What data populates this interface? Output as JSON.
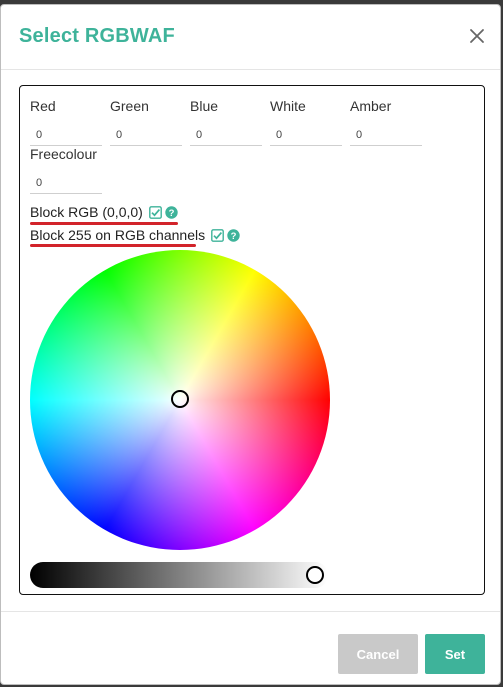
{
  "dialog": {
    "title": "Select RGBWAF",
    "close_icon": "close-icon"
  },
  "fields": [
    {
      "label": "Red",
      "value": "0"
    },
    {
      "label": "Green",
      "value": "0"
    },
    {
      "label": "Blue",
      "value": "0"
    },
    {
      "label": "White",
      "value": "0"
    },
    {
      "label": "Amber",
      "value": "0"
    },
    {
      "label": "Freecolour",
      "value": "0"
    }
  ],
  "options": {
    "block_rgb": {
      "label": "Block RGB (0,0,0)",
      "checked": true,
      "icons": [
        "checkbox-checked-icon",
        "help-icon"
      ]
    },
    "block_255": {
      "label": "Block 255 on RGB channels",
      "checked": true,
      "icons": [
        "checkbox-checked-icon",
        "help-icon"
      ]
    }
  },
  "annotation_color": "#d2232a",
  "color_picker": {
    "brightness_level": 1.0,
    "selected_position": "center"
  },
  "footer": {
    "cancel_label": "Cancel",
    "set_label": "Set"
  },
  "colors": {
    "accent": "#3eb39a",
    "cancel_bg": "#c9c9c9"
  }
}
